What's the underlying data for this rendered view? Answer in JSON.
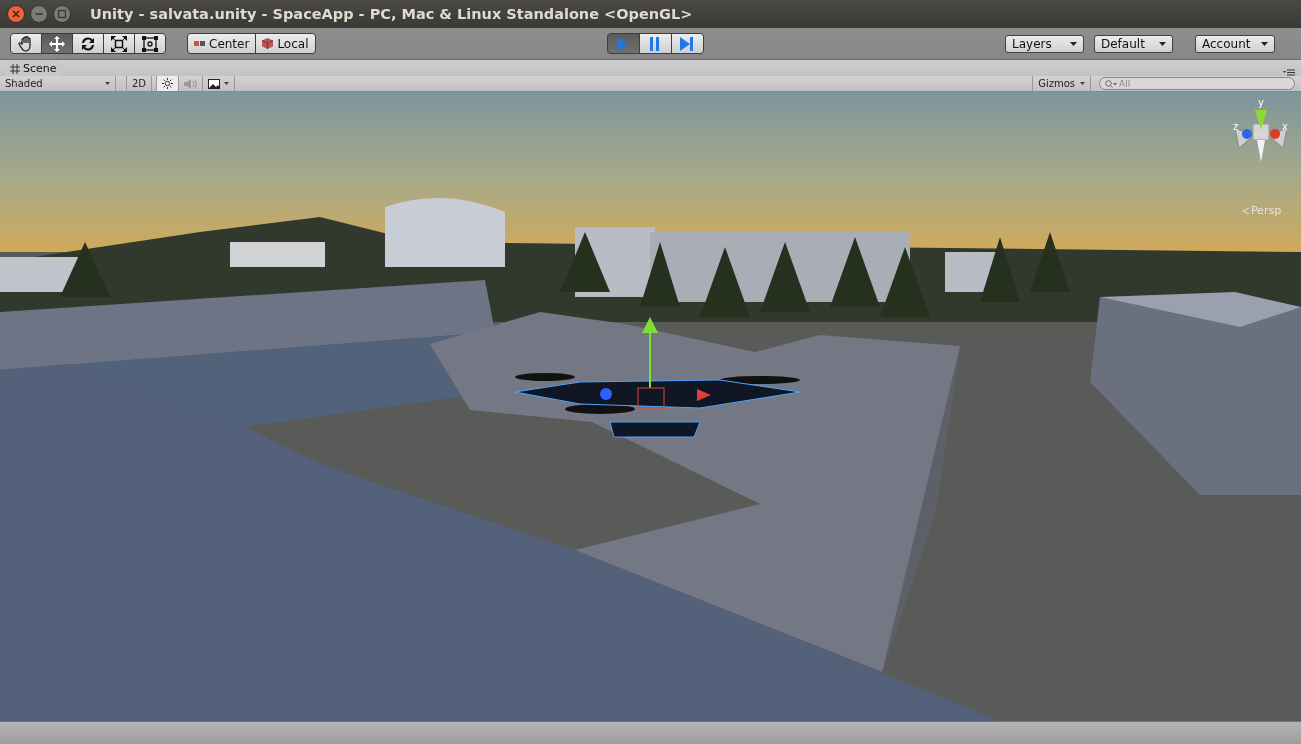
{
  "window": {
    "title": "Unity - salvata.unity - SpaceApp - PC, Mac & Linux Standalone <OpenGL>"
  },
  "toolbar": {
    "transform_tools": [
      {
        "kind": "hand",
        "selected": false
      },
      {
        "kind": "move",
        "selected": true
      },
      {
        "kind": "rotate",
        "selected": false
      },
      {
        "kind": "scale",
        "selected": false
      },
      {
        "kind": "rect",
        "selected": false
      }
    ],
    "pivot_buttons": [
      {
        "kind": "pivot",
        "label": "Center"
      },
      {
        "kind": "rotation",
        "label": "Local"
      }
    ],
    "play_controls": [
      {
        "kind": "play",
        "selected": true
      },
      {
        "kind": "pause",
        "selected": false
      },
      {
        "kind": "step",
        "selected": false
      }
    ],
    "dropdowns": [
      {
        "label": "Layers"
      },
      {
        "label": "Default"
      },
      {
        "label": "Account"
      }
    ]
  },
  "scene_tab": {
    "label": "Scene"
  },
  "scene_toolbar": {
    "shading": "Shaded",
    "mode_2d": {
      "label": "2D",
      "selected": false
    },
    "lighting": {
      "selected": true
    },
    "audio": {
      "selected": false
    },
    "gizmos": "Gizmos",
    "search": {
      "placeholder": "All"
    }
  },
  "orientation_gizmo": {
    "axes": [
      {
        "kind": "y",
        "label": "y"
      },
      {
        "kind": "z",
        "label": "z"
      },
      {
        "kind": "x",
        "label": "x"
      }
    ],
    "projection": "Persp"
  }
}
